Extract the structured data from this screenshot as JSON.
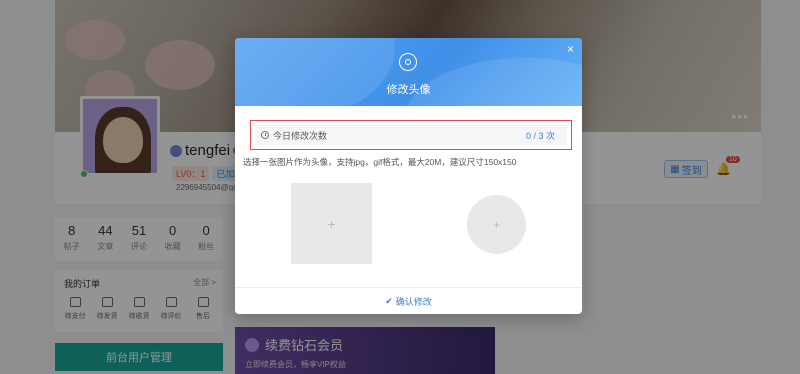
{
  "profile": {
    "username": "tengfei",
    "level_badge": "LV0：1",
    "follow_badge": "已加",
    "email": "2296945504@qq",
    "signin_label": "签到",
    "notification_count": "10",
    "more_label": "•••"
  },
  "stats": [
    {
      "value": "8",
      "label": "帖子"
    },
    {
      "value": "44",
      "label": "文章"
    },
    {
      "value": "51",
      "label": "评论"
    },
    {
      "value": "0",
      "label": "收藏"
    },
    {
      "value": "0",
      "label": "粉丝"
    }
  ],
  "orders": {
    "title": "我的订单",
    "all_label": "全部 >",
    "items": [
      {
        "label": "待支付"
      },
      {
        "label": "待发货"
      },
      {
        "label": "待收货"
      },
      {
        "label": "待评价"
      },
      {
        "label": "售后"
      }
    ]
  },
  "admin_button": "前台用户管理",
  "vip": {
    "title": "续费钻石会员",
    "subtitle": "立即续费会员，畅享VIP权益"
  },
  "modal": {
    "title": "修改头像",
    "close": "×",
    "quota_label": "今日修改次数",
    "quota_value": "0 / 3 次",
    "hint": "选择一张图片作为头像，支持jpg，gif格式，最大20M，建议尺寸150x150",
    "upload_plus": "+",
    "preview_plus": "+",
    "confirm_label": "确认修改"
  }
}
